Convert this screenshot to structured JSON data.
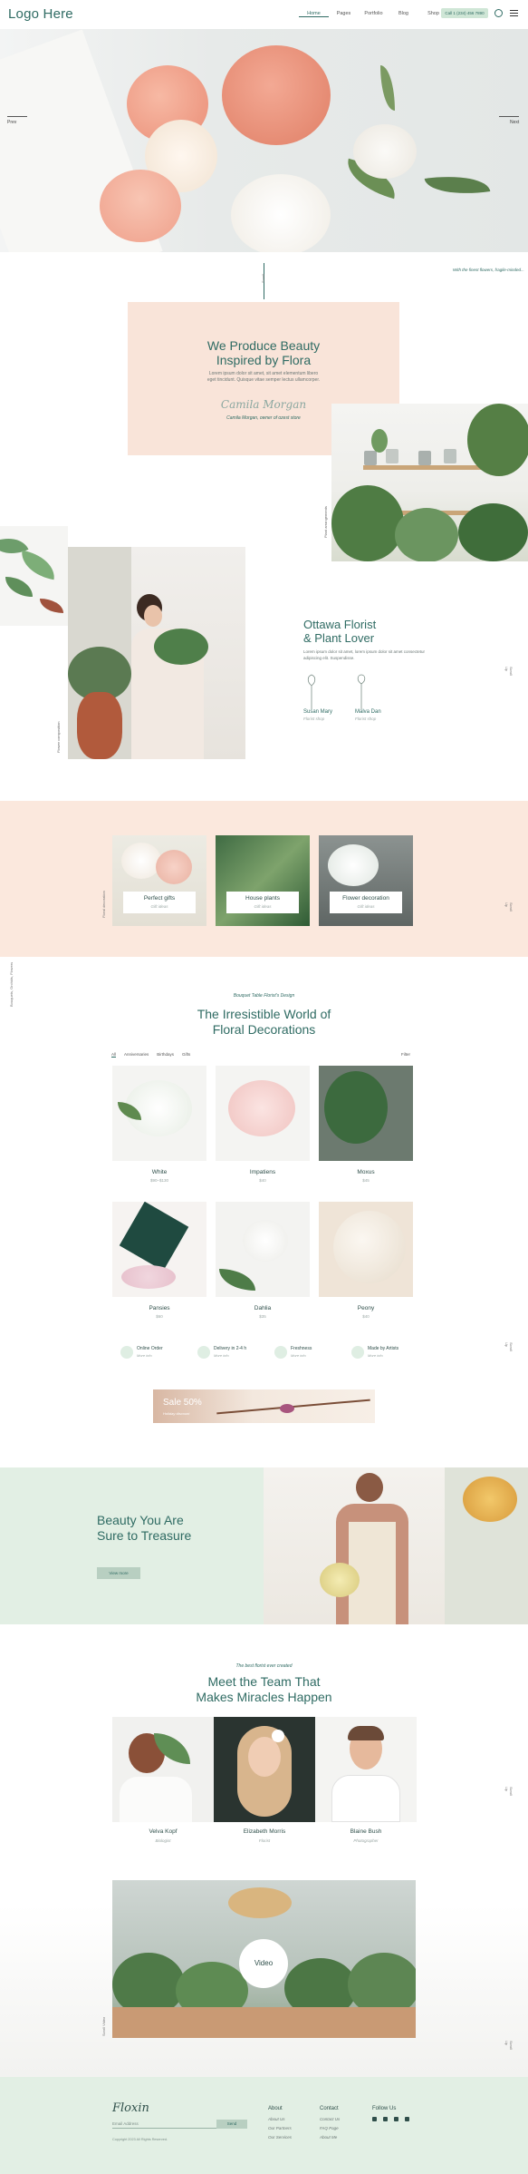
{
  "header": {
    "logo": "Logo Here",
    "nav": [
      "Home",
      "Pages",
      "Portfolio",
      "Blog",
      "Shop"
    ],
    "call": "Call 1 (234) 456 7890"
  },
  "hero": {
    "prev": "Prev",
    "next": "Next"
  },
  "about": {
    "tagline": "With the finest flowers, fragile-minded...",
    "scroll_label": "Scroll",
    "title_line1": "We Produce Beauty",
    "title_line2": "Inspired by Flora",
    "text": "Lorem ipsum dolor sit amet, sit amet elementum libero eget tincidunt. Quisque vitae semper lectus ullamcorper.",
    "signature": "Camila Morgan",
    "author": "Camila Morgan, owner of ozest store"
  },
  "plant_photo_label": "Plant arrangements",
  "florist": {
    "side_label": "Flower composition",
    "title_line1": "Ottawa Florist",
    "title_line2": "& Plant Lover",
    "text": "Lorem ipsum dolor sit amet, lorem ipsum dolor sit amet consectetur adipiscing elit. Suspendisse.",
    "people": [
      {
        "name": "Susan Mary",
        "role": "Florist shop"
      },
      {
        "name": "Malva Dan",
        "role": "Florist shop"
      }
    ],
    "scroll_side": "Scroll Up"
  },
  "categories": {
    "vert_label": "Floral decoration",
    "items": [
      {
        "title": "Perfect gifts",
        "sub": "Gift ideas"
      },
      {
        "title": "House plants",
        "sub": "Gift ideas"
      },
      {
        "title": "Flower decoration",
        "sub": "Gift ideas"
      }
    ],
    "scroll_side": "Scroll Up"
  },
  "products": {
    "side_label": "Bouquets, Orchids, Flowers",
    "sub": "Bouquet Table Florist's Design",
    "title_line1": "The Irresistible World of",
    "title_line2": "Floral Decorations",
    "filters": [
      "All",
      "Anniversaries",
      "Birthdays",
      "Gifts"
    ],
    "filter_btn": "Filter",
    "items": [
      {
        "name": "White",
        "price": "$90–$130"
      },
      {
        "name": "Impatiens",
        "price": "$40"
      },
      {
        "name": "Moxus",
        "price": "$45"
      },
      {
        "name": "Pansies",
        "price": "$60"
      },
      {
        "name": "Dahlia",
        "price": "$35"
      },
      {
        "name": "Peony",
        "price": "$40"
      }
    ],
    "features": [
      {
        "title": "Online Order",
        "sub": "More info"
      },
      {
        "title": "Delivery in 2-4 h",
        "sub": "More info"
      },
      {
        "title": "Freshness",
        "sub": "More info"
      },
      {
        "title": "Made by Artists",
        "sub": "More info"
      }
    ],
    "sale_title": "Sale 50%",
    "sale_sub": "Holiday discount",
    "scroll_side": "Scroll Up"
  },
  "treasure": {
    "title_line1": "Beauty You Are",
    "title_line2": "Sure to Treasure",
    "button": "View more"
  },
  "team": {
    "sub": "The best florist ever created",
    "title_line1": "Meet the Team That",
    "title_line2": "Makes Miracles Happen",
    "members": [
      {
        "name": "Velva Kopf",
        "role": "Biologist"
      },
      {
        "name": "Elizabeth Morris",
        "role": "Florist"
      },
      {
        "name": "Blaine Bush",
        "role": "Photographer"
      }
    ],
    "scroll_side": "Scroll Up"
  },
  "video": {
    "button": "Video",
    "side_label": "Scroll Video",
    "scroll_side": "Scroll Up"
  },
  "footer": {
    "logo": "Floxin",
    "input_placeholder": "Email Address",
    "send": "Send",
    "note": "Copyright 2023 All Rights Reserved.",
    "about": {
      "title": "About",
      "links": [
        "About Us",
        "Our Partners",
        "Our Services"
      ]
    },
    "contact": {
      "title": "Contact",
      "links": [
        "Contact Us",
        "FAQ Page",
        "About Me"
      ]
    },
    "follow": {
      "title": "Follow Us"
    }
  }
}
